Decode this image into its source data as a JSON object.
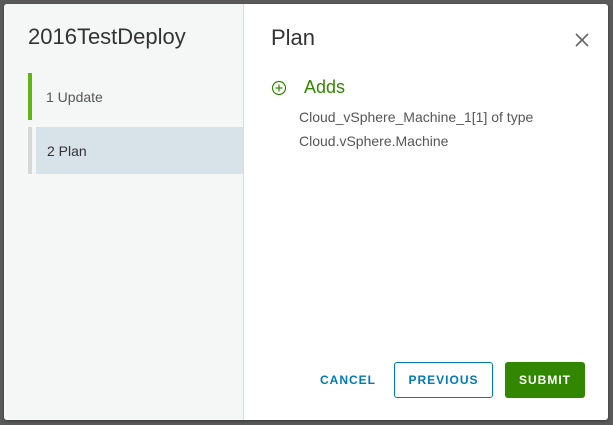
{
  "sidebar": {
    "title": "2016TestDeploy",
    "steps": [
      {
        "label": "1  Update",
        "state": "done"
      },
      {
        "label": "2  Plan",
        "state": "active"
      }
    ]
  },
  "main": {
    "title": "Plan",
    "section": {
      "icon": "plus-circle-icon",
      "label": "Adds",
      "description": "Cloud_vSphere_Machine_1[1] of type Cloud.vSphere.Machine"
    }
  },
  "footer": {
    "cancel_label": "CANCEL",
    "previous_label": "PREVIOUS",
    "submit_label": "SUBMIT"
  },
  "colors": {
    "accent_green": "#318700",
    "step_done": "#60b515",
    "link_blue": "#0079b8"
  }
}
